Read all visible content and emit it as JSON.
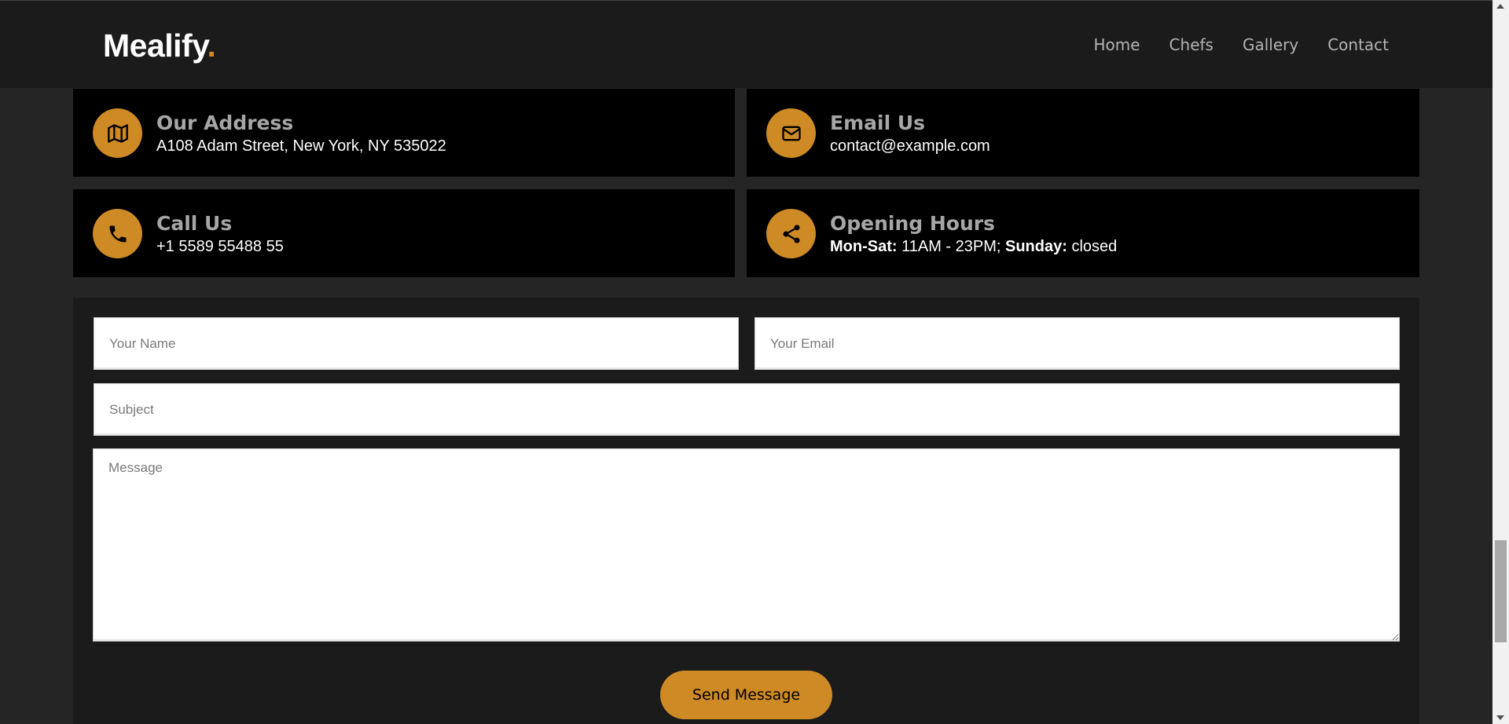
{
  "header": {
    "logo_text": "Mealify",
    "logo_dot": ".",
    "nav": [
      {
        "label": "Home"
      },
      {
        "label": "Chefs"
      },
      {
        "label": "Gallery"
      },
      {
        "label": "Contact"
      }
    ]
  },
  "info": {
    "address": {
      "title": "Our Address",
      "text": "A108 Adam Street, New York, NY 535022",
      "icon": "map-icon"
    },
    "email": {
      "title": "Email Us",
      "text": "contact@example.com",
      "icon": "envelope-icon"
    },
    "phone": {
      "title": "Call Us",
      "text": "+1 5589 55488 55",
      "icon": "phone-icon"
    },
    "hours": {
      "title": "Opening Hours",
      "weekday_label": "Mon-Sat:",
      "weekday_value": " 11AM - 23PM; ",
      "sunday_label": "Sunday:",
      "sunday_value": " closed",
      "icon": "share-icon"
    }
  },
  "form": {
    "name_placeholder": "Your Name",
    "email_placeholder": "Your Email",
    "subject_placeholder": "Subject",
    "message_placeholder": "Message",
    "submit_label": "Send Message"
  },
  "colors": {
    "accent": "#cd8a25",
    "header_bg": "#1b1b1b",
    "box_bg": "#000000"
  }
}
